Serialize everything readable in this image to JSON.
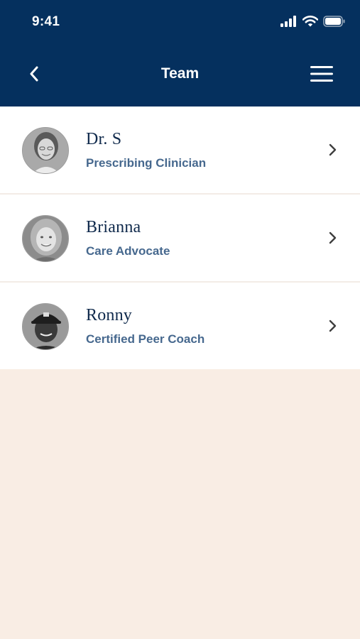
{
  "status_bar": {
    "time": "9:41",
    "icons": [
      "signal-icon",
      "wifi-icon",
      "battery-icon"
    ]
  },
  "nav": {
    "title": "Team",
    "back_icon": "chevron-left-icon",
    "menu_icon": "hamburger-menu-icon"
  },
  "team": [
    {
      "name": "Dr. S",
      "role": "Prescribing Clinician"
    },
    {
      "name": "Brianna",
      "role": "Care Advocate"
    },
    {
      "name": "Ronny",
      "role": "Certified Peer Coach"
    }
  ],
  "colors": {
    "header_bg": "#05305e",
    "page_bg": "#f9ede4",
    "name_text": "#102a4c",
    "role_text": "#46688e"
  }
}
